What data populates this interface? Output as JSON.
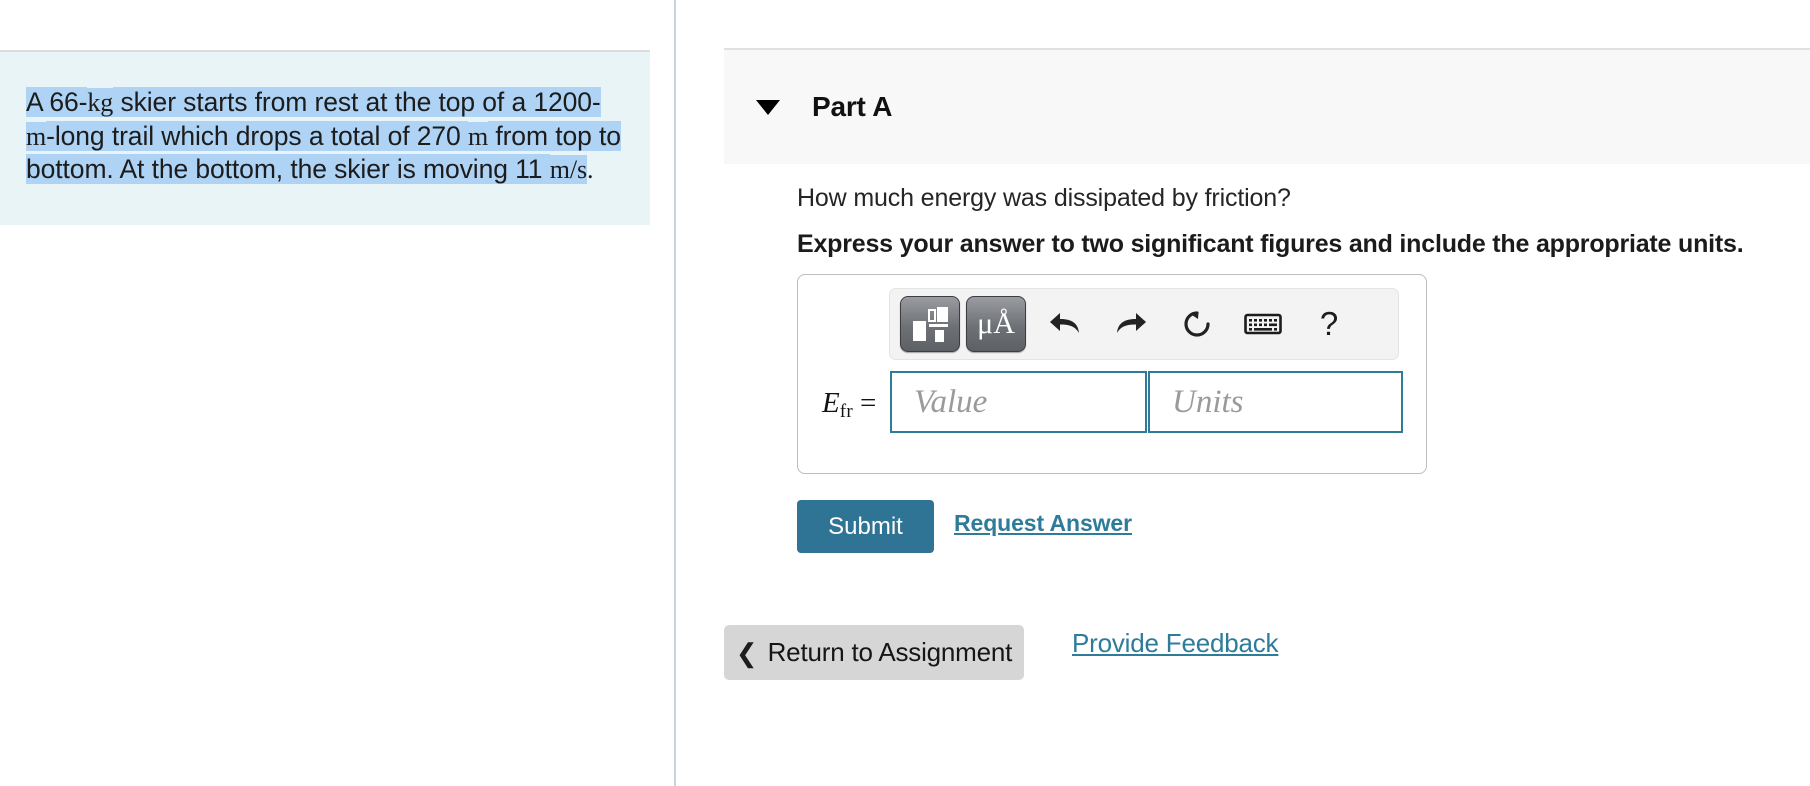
{
  "problem": {
    "segments": [
      {
        "text": "A 66-",
        "style": "sans",
        "highlighted": true
      },
      {
        "text": "kg",
        "style": "math",
        "highlighted": true
      },
      {
        "text": " skier starts from rest at the top of a 1200-",
        "style": "sans",
        "highlighted": true
      },
      {
        "text": "m",
        "style": "math",
        "highlighted": true
      },
      {
        "text": "-long trail which drops a total of 270 ",
        "style": "sans",
        "highlighted": true
      },
      {
        "text": "m",
        "style": "math",
        "highlighted": true
      },
      {
        "text": " from top to bottom. At the bottom, the skier is moving 11 ",
        "style": "sans",
        "highlighted": true
      },
      {
        "text": "m/s",
        "style": "math",
        "highlighted": true
      },
      {
        "text": ".",
        "style": "sans",
        "highlighted": false
      }
    ],
    "plain_text": "A 66-kg skier starts from rest at the top of a 1200-m-long trail which drops a total of 270 m from top to bottom. At the bottom, the skier is moving 11 m/s.",
    "highlight_color": "#aed3f5",
    "background_color": "#e9f4f6"
  },
  "part": {
    "title": "Part A",
    "collapse_icon": "triangle-down-icon",
    "question": "How much energy was dissipated by friction?",
    "instruction": "Express your answer to two significant figures and include the appropriate units."
  },
  "answer_widget": {
    "toolbar": [
      {
        "name": "math-template-icon",
        "label": ""
      },
      {
        "name": "greek-units-icon",
        "label": "μÅ"
      },
      {
        "name": "undo-icon",
        "label": "↶"
      },
      {
        "name": "redo-icon",
        "label": "↷"
      },
      {
        "name": "reset-icon",
        "label": "↺"
      },
      {
        "name": "keyboard-icon",
        "label": "⌨"
      },
      {
        "name": "help-icon",
        "label": "?"
      }
    ],
    "variable_symbol": "E",
    "variable_subscript": "fr",
    "equals_sign": "=",
    "value_placeholder": "Value",
    "units_placeholder": "Units",
    "value_current": "",
    "units_current": "",
    "field_border_color": "#2e7c99"
  },
  "actions": {
    "submit_label": "Submit",
    "submit_color": "#2f7495",
    "request_answer_label": "Request Answer",
    "link_color": "#2e7c99"
  },
  "footer": {
    "return_chevron": "❮",
    "return_label": "Return to Assignment",
    "provide_feedback_label": "Provide Feedback"
  }
}
